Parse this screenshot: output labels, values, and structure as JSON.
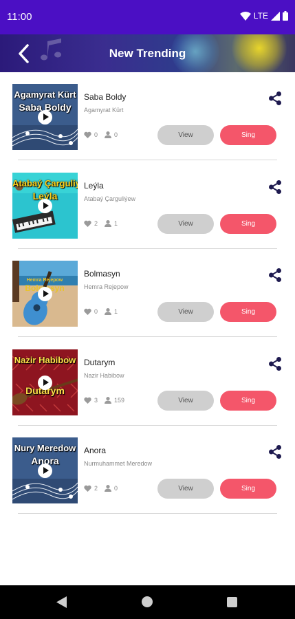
{
  "status_bar": {
    "time": "11:00",
    "network": "LTE"
  },
  "header": {
    "title": "New Trending"
  },
  "icons": {
    "back": "back-arrow-icon",
    "share": "share-icon",
    "like": "heart-icon",
    "singers": "person-icon",
    "play": "play-icon"
  },
  "songs": [
    {
      "title": "Saba Boldy",
      "artist": "Agamyrat Kürt",
      "likes": "0",
      "singers": "0",
      "cover_line1": "Agamyrat Kürt",
      "cover_line2": "Saba Boldy",
      "view_label": "View",
      "sing_label": "Sing"
    },
    {
      "title": "Leýla",
      "artist": "Atabaý Çarguliýew",
      "likes": "2",
      "singers": "1",
      "cover_line1": "Atabaý Çarguliýew",
      "cover_line2": "Leýla",
      "view_label": "View",
      "sing_label": "Sing"
    },
    {
      "title": "Bolmasyn",
      "artist": "Hemra Rejepow",
      "likes": "0",
      "singers": "1",
      "cover_line1": "",
      "cover_line2": "",
      "view_label": "View",
      "sing_label": "Sing"
    },
    {
      "title": "Dutarym",
      "artist": "Nazir Habibow",
      "likes": "3",
      "singers": "159",
      "cover_line1": "Nazir Habibow",
      "cover_line2": "Dutarym",
      "view_label": "View",
      "sing_label": "Sing"
    },
    {
      "title": "Anora",
      "artist": "Nurmuhammet Meredow",
      "likes": "2",
      "singers": "0",
      "cover_line1": "Nury Meredow",
      "cover_line2": "Anora",
      "view_label": "View",
      "sing_label": "Sing"
    }
  ],
  "colors": {
    "status_bar": "#4b0fc4",
    "sing_button": "#f4566a",
    "view_button": "#cfcfcf",
    "share_icon": "#1e1a4f"
  }
}
